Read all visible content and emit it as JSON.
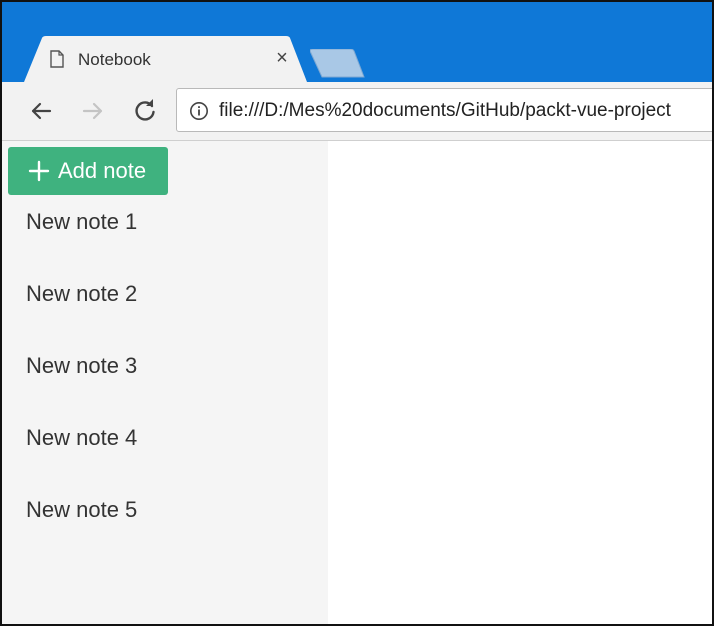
{
  "browser": {
    "tab": {
      "title": "Notebook",
      "favicon": "document-icon",
      "close_icon": "close-icon"
    },
    "new_tab_icon": "new-tab-icon",
    "toolbar": {
      "back_icon": "back-arrow-icon",
      "forward_icon": "forward-arrow-icon",
      "reload_icon": "reload-icon",
      "info_icon": "info-icon",
      "url": "file:///D:/Mes%20documents/GitHub/packt-vue-project"
    },
    "colors": {
      "tabstrip": "#0f78d7",
      "toolbar": "#f2f2f2"
    }
  },
  "app": {
    "add_note_button": {
      "icon": "plus-icon",
      "label": "Add note",
      "color": "#3fb27f"
    },
    "notes": [
      {
        "title": "New note 1"
      },
      {
        "title": "New note 2"
      },
      {
        "title": "New note 3"
      },
      {
        "title": "New note 4"
      },
      {
        "title": "New note 5"
      }
    ],
    "colors": {
      "sidebar_bg": "#f5f5f5",
      "note_text": "#333333"
    }
  }
}
